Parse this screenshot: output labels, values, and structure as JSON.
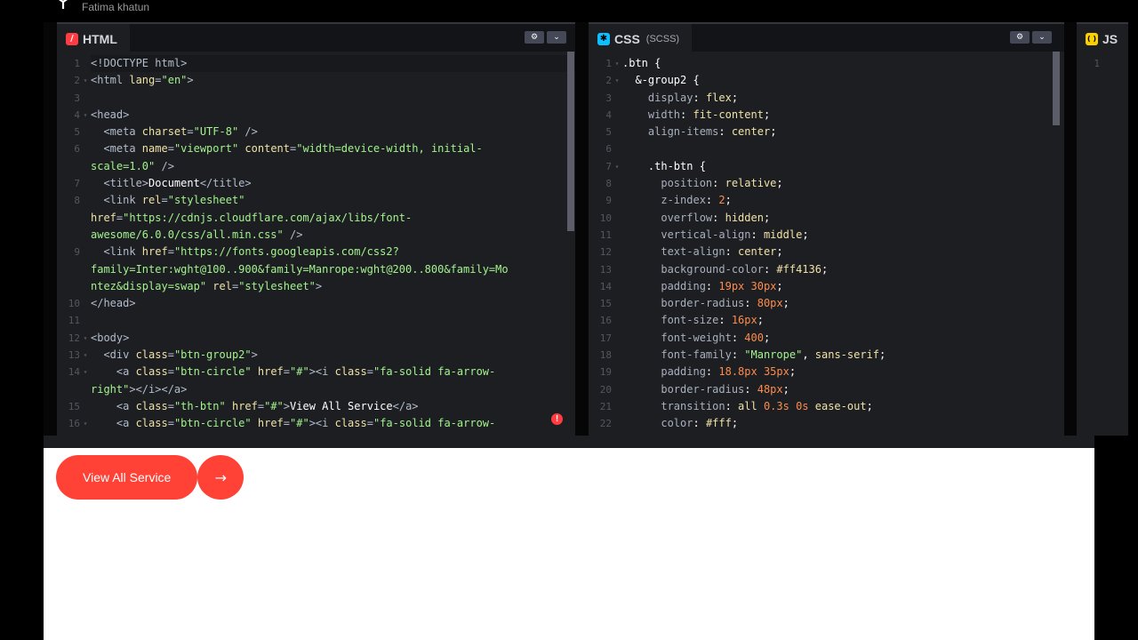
{
  "header": {
    "author": "Fatima khatun",
    "logo_icon": "codepen-cube-icon"
  },
  "colors": {
    "accent": "#ff4136",
    "html_badge": "#ff3c41",
    "css_badge": "#0ebeff",
    "js_badge": "#fcd000"
  },
  "html_pane": {
    "name": "HTML",
    "badge": "/",
    "lines": [
      {
        "n": "1",
        "fold": "",
        "active": true,
        "parts": [
          [
            "tg",
            "<!DOCTYPE html>"
          ]
        ]
      },
      {
        "n": "2",
        "fold": "▾",
        "parts": [
          [
            "tg",
            "<html "
          ],
          [
            "at",
            "lang"
          ],
          [
            "tg",
            "="
          ],
          [
            "st",
            "\"en\""
          ],
          [
            "tg",
            ">"
          ]
        ]
      },
      {
        "n": "3",
        "fold": "",
        "parts": []
      },
      {
        "n": "4",
        "fold": "▾",
        "parts": [
          [
            "tg",
            "<head>"
          ]
        ]
      },
      {
        "n": "5",
        "fold": "",
        "parts": [
          [
            "tg",
            "  <meta "
          ],
          [
            "at",
            "charset"
          ],
          [
            "tg",
            "="
          ],
          [
            "st",
            "\"UTF-8\""
          ],
          [
            "tg",
            " />"
          ]
        ]
      },
      {
        "n": "6",
        "fold": "",
        "parts": [
          [
            "tg",
            "  <meta "
          ],
          [
            "at",
            "name"
          ],
          [
            "tg",
            "="
          ],
          [
            "st",
            "\"viewport\""
          ],
          [
            "tg",
            " "
          ],
          [
            "at",
            "content"
          ],
          [
            "tg",
            "="
          ],
          [
            "st",
            "\"width=device-width, initial-"
          ]
        ]
      },
      {
        "n": "",
        "fold": "",
        "parts": [
          [
            "st",
            "scale=1.0\""
          ],
          [
            "tg",
            " />"
          ]
        ]
      },
      {
        "n": "7",
        "fold": "",
        "parts": [
          [
            "tg",
            "  <title>"
          ],
          [
            "pl",
            "Document"
          ],
          [
            "tg",
            "</title>"
          ]
        ]
      },
      {
        "n": "8",
        "fold": "",
        "parts": [
          [
            "tg",
            "  <link "
          ],
          [
            "at",
            "rel"
          ],
          [
            "tg",
            "="
          ],
          [
            "st",
            "\"stylesheet\""
          ]
        ]
      },
      {
        "n": "",
        "fold": "",
        "parts": [
          [
            "at",
            "href"
          ],
          [
            "tg",
            "="
          ],
          [
            "st",
            "\"https://cdnjs.cloudflare.com/ajax/libs/font-"
          ]
        ]
      },
      {
        "n": "",
        "fold": "",
        "parts": [
          [
            "st",
            "awesome/6.0.0/css/all.min.css\""
          ],
          [
            "tg",
            " />"
          ]
        ]
      },
      {
        "n": "9",
        "fold": "",
        "parts": [
          [
            "tg",
            "  <link "
          ],
          [
            "at",
            "href"
          ],
          [
            "tg",
            "="
          ],
          [
            "st",
            "\"https://fonts.googleapis.com/css2?"
          ]
        ]
      },
      {
        "n": "",
        "fold": "",
        "parts": [
          [
            "st",
            "family=Inter:wght@100..900&family=Manrope:wght@200..800&family=Mo"
          ]
        ]
      },
      {
        "n": "",
        "fold": "",
        "parts": [
          [
            "st",
            "ntez&display=swap\""
          ],
          [
            "tg",
            " "
          ],
          [
            "at",
            "rel"
          ],
          [
            "tg",
            "="
          ],
          [
            "st",
            "\"stylesheet\""
          ],
          [
            "tg",
            ">"
          ]
        ]
      },
      {
        "n": "10",
        "fold": "",
        "parts": [
          [
            "tg",
            "</head>"
          ]
        ]
      },
      {
        "n": "11",
        "fold": "",
        "parts": []
      },
      {
        "n": "12",
        "fold": "▾",
        "parts": [
          [
            "tg",
            "<body>"
          ]
        ]
      },
      {
        "n": "13",
        "fold": "▾",
        "parts": [
          [
            "tg",
            "  <div "
          ],
          [
            "at",
            "class"
          ],
          [
            "tg",
            "="
          ],
          [
            "st",
            "\"btn-group2\""
          ],
          [
            "tg",
            ">"
          ]
        ]
      },
      {
        "n": "14",
        "fold": "▾",
        "parts": [
          [
            "tg",
            "    <a "
          ],
          [
            "at",
            "class"
          ],
          [
            "tg",
            "="
          ],
          [
            "st",
            "\"btn-circle\""
          ],
          [
            "tg",
            " "
          ],
          [
            "at",
            "href"
          ],
          [
            "tg",
            "="
          ],
          [
            "st",
            "\"#\""
          ],
          [
            "tg",
            "><i "
          ],
          [
            "at",
            "class"
          ],
          [
            "tg",
            "="
          ],
          [
            "st",
            "\"fa-solid fa-arrow-"
          ]
        ]
      },
      {
        "n": "",
        "fold": "",
        "parts": [
          [
            "st",
            "right\""
          ],
          [
            "tg",
            "></i></a>"
          ]
        ]
      },
      {
        "n": "15",
        "fold": "",
        "parts": [
          [
            "tg",
            "    <a "
          ],
          [
            "at",
            "class"
          ],
          [
            "tg",
            "="
          ],
          [
            "st",
            "\"th-btn\""
          ],
          [
            "tg",
            " "
          ],
          [
            "at",
            "href"
          ],
          [
            "tg",
            "="
          ],
          [
            "st",
            "\"#\""
          ],
          [
            "tg",
            ">"
          ],
          [
            "pl",
            "View All Service"
          ],
          [
            "tg",
            "</a>"
          ]
        ]
      },
      {
        "n": "16",
        "fold": "▾",
        "parts": [
          [
            "tg",
            "    <a "
          ],
          [
            "at",
            "class"
          ],
          [
            "tg",
            "="
          ],
          [
            "st",
            "\"btn-circle\""
          ],
          [
            "tg",
            " "
          ],
          [
            "at",
            "href"
          ],
          [
            "tg",
            "="
          ],
          [
            "st",
            "\"#\""
          ],
          [
            "tg",
            "><i "
          ],
          [
            "at",
            "class"
          ],
          [
            "tg",
            "="
          ],
          [
            "st",
            "\"fa-solid fa-arrow-"
          ]
        ]
      }
    ]
  },
  "css_pane": {
    "name": "CSS",
    "sub": "(SCSS)",
    "badge": "✱",
    "lines": [
      {
        "n": "1",
        "fold": "▾",
        "parts": [
          [
            "sel",
            ".btn {"
          ]
        ]
      },
      {
        "n": "2",
        "fold": "▾",
        "parts": [
          [
            "sel",
            "  &-group2 {"
          ]
        ]
      },
      {
        "n": "3",
        "fold": "",
        "parts": [
          [
            "pr",
            "    display"
          ],
          [
            "sel",
            ": "
          ],
          [
            "vl",
            "flex"
          ],
          [
            "sel",
            ";"
          ]
        ]
      },
      {
        "n": "4",
        "fold": "",
        "parts": [
          [
            "pr",
            "    width"
          ],
          [
            "sel",
            ": "
          ],
          [
            "vl",
            "fit-content"
          ],
          [
            "sel",
            ";"
          ]
        ]
      },
      {
        "n": "5",
        "fold": "",
        "parts": [
          [
            "pr",
            "    align-items"
          ],
          [
            "sel",
            ": "
          ],
          [
            "vl",
            "center"
          ],
          [
            "sel",
            ";"
          ]
        ]
      },
      {
        "n": "6",
        "fold": "",
        "parts": []
      },
      {
        "n": "7",
        "fold": "▾",
        "parts": [
          [
            "sel",
            "    .th-btn {"
          ]
        ]
      },
      {
        "n": "8",
        "fold": "",
        "parts": [
          [
            "pr",
            "      position"
          ],
          [
            "sel",
            ": "
          ],
          [
            "vl",
            "relative"
          ],
          [
            "sel",
            ";"
          ]
        ]
      },
      {
        "n": "9",
        "fold": "",
        "parts": [
          [
            "pr",
            "      z-index"
          ],
          [
            "sel",
            ": "
          ],
          [
            "nm",
            "2"
          ],
          [
            "sel",
            ";"
          ]
        ]
      },
      {
        "n": "10",
        "fold": "",
        "parts": [
          [
            "pr",
            "      overflow"
          ],
          [
            "sel",
            ": "
          ],
          [
            "vl",
            "hidden"
          ],
          [
            "sel",
            ";"
          ]
        ]
      },
      {
        "n": "11",
        "fold": "",
        "parts": [
          [
            "pr",
            "      vertical-align"
          ],
          [
            "sel",
            ": "
          ],
          [
            "vl",
            "middle"
          ],
          [
            "sel",
            ";"
          ]
        ]
      },
      {
        "n": "12",
        "fold": "",
        "parts": [
          [
            "pr",
            "      text-align"
          ],
          [
            "sel",
            ": "
          ],
          [
            "vl",
            "center"
          ],
          [
            "sel",
            ";"
          ]
        ]
      },
      {
        "n": "13",
        "fold": "",
        "parts": [
          [
            "pr",
            "      background-color"
          ],
          [
            "sel",
            ": "
          ],
          [
            "vl",
            "#ff4136"
          ],
          [
            "sel",
            ";"
          ]
        ]
      },
      {
        "n": "14",
        "fold": "",
        "parts": [
          [
            "pr",
            "      padding"
          ],
          [
            "sel",
            ": "
          ],
          [
            "nm",
            "19px 30px"
          ],
          [
            "sel",
            ";"
          ]
        ]
      },
      {
        "n": "15",
        "fold": "",
        "parts": [
          [
            "pr",
            "      border-radius"
          ],
          [
            "sel",
            ": "
          ],
          [
            "nm",
            "80px"
          ],
          [
            "sel",
            ";"
          ]
        ]
      },
      {
        "n": "16",
        "fold": "",
        "parts": [
          [
            "pr",
            "      font-size"
          ],
          [
            "sel",
            ": "
          ],
          [
            "nm",
            "16px"
          ],
          [
            "sel",
            ";"
          ]
        ]
      },
      {
        "n": "17",
        "fold": "",
        "parts": [
          [
            "pr",
            "      font-weight"
          ],
          [
            "sel",
            ": "
          ],
          [
            "nm",
            "400"
          ],
          [
            "sel",
            ";"
          ]
        ]
      },
      {
        "n": "18",
        "fold": "",
        "parts": [
          [
            "pr",
            "      font-family"
          ],
          [
            "sel",
            ": "
          ],
          [
            "sv",
            "\"Manrope\""
          ],
          [
            "sel",
            ", "
          ],
          [
            "vl",
            "sans-serif"
          ],
          [
            "sel",
            ";"
          ]
        ]
      },
      {
        "n": "19",
        "fold": "",
        "parts": [
          [
            "pr",
            "      padding"
          ],
          [
            "sel",
            ": "
          ],
          [
            "nm",
            "18.8px 35px"
          ],
          [
            "sel",
            ";"
          ]
        ]
      },
      {
        "n": "20",
        "fold": "",
        "parts": [
          [
            "pr",
            "      border-radius"
          ],
          [
            "sel",
            ": "
          ],
          [
            "nm",
            "48px"
          ],
          [
            "sel",
            ";"
          ]
        ]
      },
      {
        "n": "21",
        "fold": "",
        "parts": [
          [
            "pr",
            "      transition"
          ],
          [
            "sel",
            ": "
          ],
          [
            "vl",
            "all "
          ],
          [
            "nm",
            "0.3s 0s"
          ],
          [
            "vl",
            " ease-out"
          ],
          [
            "sel",
            ";"
          ]
        ]
      },
      {
        "n": "22",
        "fold": "",
        "parts": [
          [
            "pr",
            "      color"
          ],
          [
            "sel",
            ": "
          ],
          [
            "vl",
            "#fff"
          ],
          [
            "sel",
            ";"
          ]
        ]
      }
    ]
  },
  "js_pane": {
    "name": "JS",
    "badge": "( )",
    "lines": [
      {
        "n": "1",
        "fold": "",
        "parts": []
      }
    ]
  },
  "preview": {
    "button_label": "View All Service",
    "circle_icon": "→"
  }
}
